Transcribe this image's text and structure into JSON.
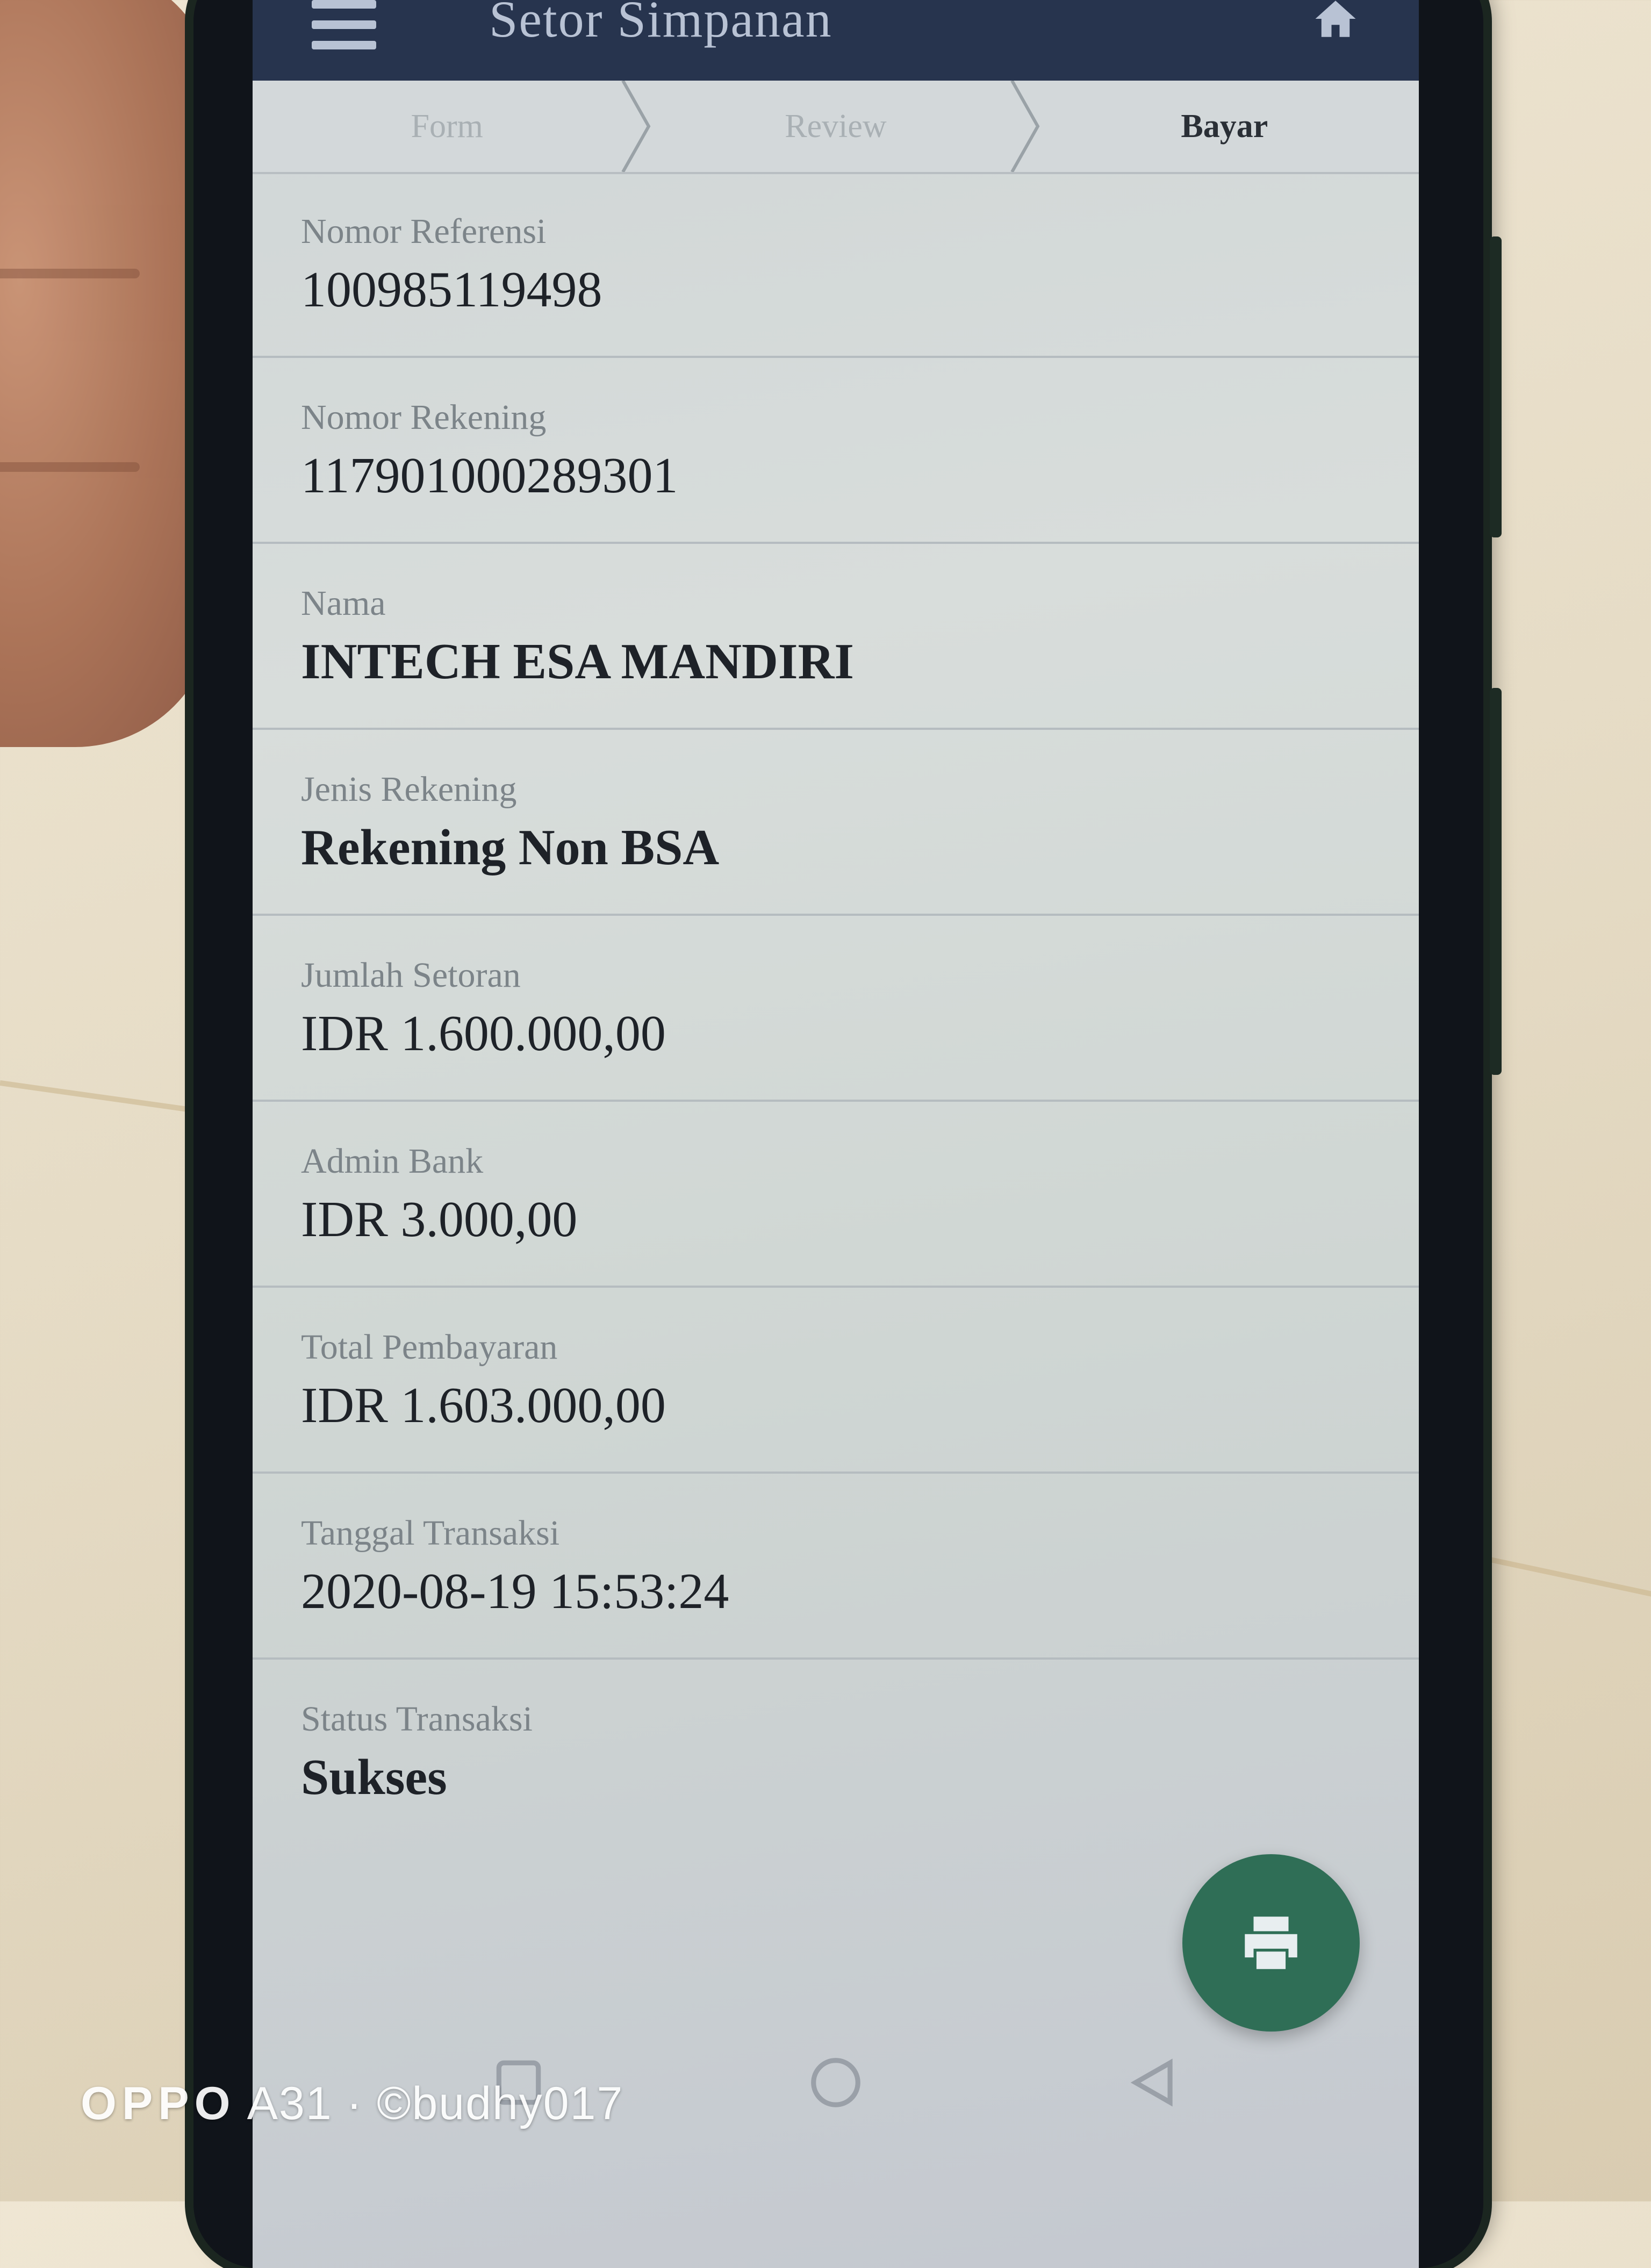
{
  "app": {
    "title": "Setor Simpanan"
  },
  "stepper": {
    "steps": [
      {
        "label": "Form",
        "active": false
      },
      {
        "label": "Review",
        "active": false
      },
      {
        "label": "Bayar",
        "active": true
      }
    ]
  },
  "details": [
    {
      "label": "Nomor Referensi",
      "value": "100985119498"
    },
    {
      "label": "Nomor Rekening",
      "value": "117901000289301"
    },
    {
      "label": "Nama",
      "value": "INTECH ESA MANDIRI"
    },
    {
      "label": "Jenis Rekening",
      "value": "Rekening Non BSA"
    },
    {
      "label": "Jumlah Setoran",
      "value": "IDR 1.600.000,00"
    },
    {
      "label": "Admin Bank",
      "value": "IDR 3.000,00"
    },
    {
      "label": "Total Pembayaran",
      "value": "IDR 1.603.000,00"
    },
    {
      "label": "Tanggal Transaksi",
      "value": "2020-08-19 15:53:24"
    },
    {
      "label": "Status Transaksi",
      "value": "Sukses"
    }
  ],
  "icons": {
    "menu": "menu-icon",
    "home": "home-icon",
    "print": "print-icon",
    "nav_recent": "square-icon",
    "nav_home": "circle-icon",
    "nav_back": "triangle-back-icon"
  },
  "colors": {
    "appbar": "#27344e",
    "fab": "#2f6e56"
  },
  "watermark": {
    "brand": "OPPO",
    "text": " A31 · ©budhy017"
  }
}
